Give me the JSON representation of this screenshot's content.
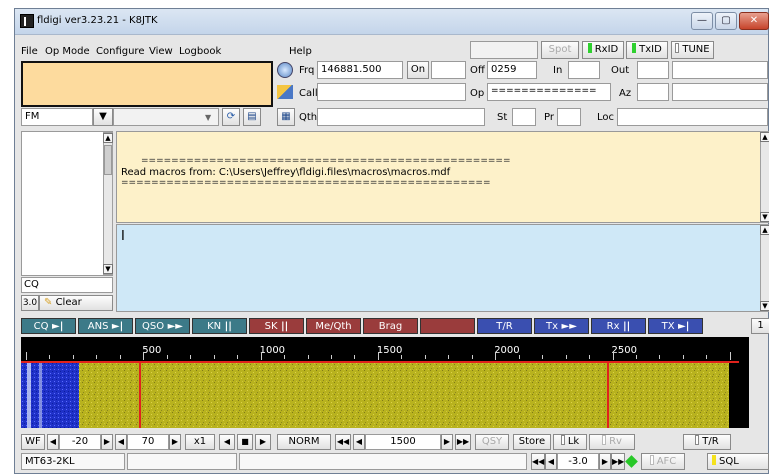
{
  "window": {
    "title": "fldigi ver3.23.21 - K8JTK"
  },
  "menu": [
    "File",
    "Op Mode",
    "Configure",
    "View",
    "Logbook",
    "Help"
  ],
  "top_indicators": {
    "spot": "Spot",
    "rxid": "RxID",
    "txid": "TxID",
    "tune": "TUNE"
  },
  "log": {
    "frq_label": "Frq",
    "frq_value": "146881.500",
    "on_label": "On",
    "on_value": "",
    "off_label": "Off",
    "off_value": "0259",
    "in_label": "In",
    "out_label": "Out",
    "call_label": "Call",
    "op_label": "Op",
    "op_value": "==============",
    "az_label": "Az",
    "qth_label": "Qth",
    "st_label": "St",
    "pr_label": "Pr",
    "loc_label": "Loc"
  },
  "mode": {
    "value": "FM"
  },
  "rx_text": {
    "line1": "=================================================",
    "line2": "Read macros from: C:\\Users\\Jeffrey\\fldigi.files\\macros\\macros.mdf",
    "line3": "================================================="
  },
  "tx_text": {
    "cursor": "I"
  },
  "side": {
    "cq_field": "CQ",
    "ver": "3.0",
    "clear": "Clear"
  },
  "macros": [
    {
      "label": "CQ",
      "icon": "►|",
      "color": "#3c7a88"
    },
    {
      "label": "ANS",
      "icon": "►|",
      "color": "#3c7a88"
    },
    {
      "label": "QSO",
      "icon": "►►",
      "color": "#3c7a88"
    },
    {
      "label": "KN",
      "icon": "||",
      "color": "#3c7a88"
    },
    {
      "label": "SK",
      "icon": "||",
      "color": "#9a3c3c"
    },
    {
      "label": "Me/Qth",
      "icon": "",
      "color": "#9a3c3c"
    },
    {
      "label": "Brag",
      "icon": "",
      "color": "#9a3c3c"
    },
    {
      "label": "",
      "icon": "",
      "color": "#9a3c3c"
    },
    {
      "label": "T/R",
      "icon": "",
      "color": "#3a4fb0"
    },
    {
      "label": "Tx",
      "icon": "►►",
      "color": "#3a4fb0"
    },
    {
      "label": "Rx",
      "icon": "||",
      "color": "#3a4fb0"
    },
    {
      "label": "TX",
      "icon": "►|",
      "color": "#3a4fb0"
    }
  ],
  "macro_page": "1",
  "waterfall": {
    "scale_labels": [
      "500",
      "1000",
      "1500",
      "2000",
      "2500"
    ],
    "colors": {
      "bg": "#b8b21e",
      "signal": "#1f31c8",
      "marker": "#e0221c"
    }
  },
  "bottom_bar": {
    "wf": "WF",
    "ref": "-20",
    "range": "70",
    "zoom": "x1",
    "speed": "NORM",
    "carrier": "1500",
    "qsy": "QSY",
    "store": "Store",
    "lk": "Lk",
    "rv": "Rv",
    "tr": "T/R"
  },
  "status_bar": {
    "mode": "MT63-2KL",
    "s2n": "-3.0",
    "afc": "AFC",
    "sql": "SQL"
  }
}
